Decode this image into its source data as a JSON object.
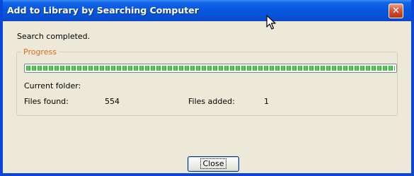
{
  "window": {
    "title": "Add to Library by Searching Computer",
    "close_glyph": "✕"
  },
  "status_text": "Search completed.",
  "progress_group": {
    "legend": "Progress",
    "progress_fraction": 1.0,
    "current_folder_label": "Current folder:",
    "current_folder_value": "",
    "files_found_label": "Files found:",
    "files_found_value": "554",
    "files_added_label": "Files added:",
    "files_added_value": "1"
  },
  "buttons": {
    "close_label": "Close"
  },
  "colors": {
    "titlebar": "#0a58e0",
    "dialog_bg": "#ece9d8",
    "legend_text": "#e0661f",
    "progress_fill": "#33b33a"
  },
  "icons": {
    "cursor": "arrow-cursor-icon"
  }
}
